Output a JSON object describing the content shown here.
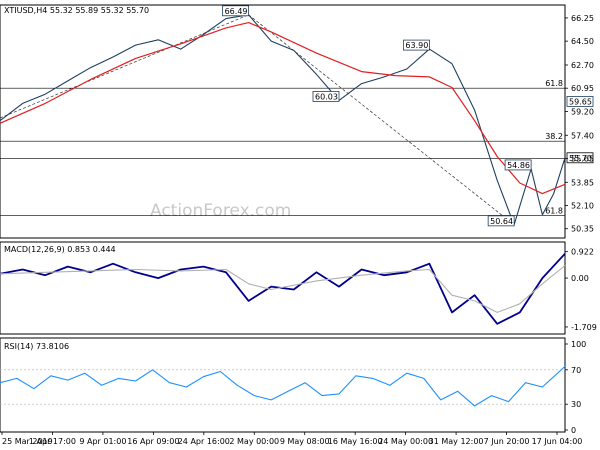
{
  "chart_data": [
    {
      "type": "line",
      "panel": "price",
      "header": "XTIUSD,H4  55.32 55.89 55.32 55.70",
      "ylim": [
        49.8,
        67.0
      ],
      "y_ticks": [
        "66.25",
        "64.50",
        "62.70",
        "60.95",
        "59.20",
        "57.40",
        "55.65",
        "53.85",
        "52.10",
        "50.35"
      ],
      "y_tick_values": [
        66.25,
        64.5,
        62.7,
        60.95,
        59.2,
        57.4,
        55.65,
        53.85,
        52.1,
        50.35
      ],
      "current_price": "55.70",
      "current_price_value": 55.7,
      "series": [
        {
          "kind": "price",
          "color": "#1f3f60",
          "x": [
            0,
            4,
            8,
            12,
            16,
            20,
            24,
            28,
            32,
            36,
            40,
            44,
            48,
            52,
            56,
            60,
            64,
            68,
            72,
            76,
            80,
            84,
            88,
            91,
            94,
            96,
            98,
            100
          ],
          "y": [
            58.5,
            59.8,
            60.5,
            61.5,
            62.5,
            63.3,
            64.2,
            64.6,
            63.9,
            65.0,
            66.2,
            66.49,
            64.5,
            63.8,
            62.0,
            60.03,
            61.3,
            61.8,
            62.4,
            63.9,
            62.8,
            59.3,
            54.0,
            50.64,
            54.86,
            51.4,
            53.0,
            55.7
          ]
        },
        {
          "kind": "moving-average",
          "color": "#e02020",
          "x": [
            0,
            8,
            16,
            24,
            32,
            40,
            44,
            48,
            56,
            64,
            70,
            76,
            80,
            84,
            88,
            92,
            96,
            100
          ],
          "y": [
            58.3,
            59.8,
            61.6,
            63.2,
            64.3,
            65.5,
            65.9,
            65.2,
            63.6,
            62.2,
            61.9,
            61.8,
            61.0,
            58.5,
            55.8,
            53.8,
            53.0,
            53.7
          ]
        }
      ],
      "levels": [
        {
          "name": "61.8",
          "value": 60.95,
          "color": "#000000"
        },
        {
          "name": "38.2",
          "value": 56.95,
          "color": "#000000"
        },
        {
          "name": "61.8",
          "value": 51.35,
          "color": "#000000"
        },
        {
          "name": "",
          "value": 55.65,
          "color": "#000000"
        }
      ],
      "annotations": [
        {
          "text": "66.49",
          "value": 66.49
        },
        {
          "text": "63.90",
          "value": 63.9
        },
        {
          "text": "60.03",
          "value": 60.03
        },
        {
          "text": "54.86",
          "value": 54.86
        },
        {
          "text": "50.64",
          "value": 50.64
        },
        {
          "text": "59.65",
          "value": 59.65
        }
      ]
    },
    {
      "type": "line",
      "panel": "macd",
      "header": "MACD(12,26,9) 0.853 0.444",
      "ylim": [
        -1.85,
        1.05
      ],
      "y_ticks": [
        "0.922",
        "0.00",
        "-1.709"
      ],
      "y_tick_values": [
        0.922,
        0.0,
        -1.709
      ],
      "series": [
        {
          "kind": "macd",
          "color": "#00008b",
          "x": [
            0,
            4,
            8,
            12,
            16,
            20,
            24,
            28,
            32,
            36,
            40,
            44,
            48,
            52,
            56,
            60,
            64,
            68,
            72,
            76,
            80,
            84,
            88,
            92,
            96,
            100
          ],
          "y": [
            0.15,
            0.3,
            0.1,
            0.4,
            0.2,
            0.5,
            0.2,
            0.0,
            0.3,
            0.4,
            0.2,
            -0.8,
            -0.3,
            -0.4,
            0.2,
            -0.3,
            0.3,
            0.1,
            0.2,
            0.5,
            -1.2,
            -0.6,
            -1.6,
            -1.2,
            0.0,
            0.85
          ]
        },
        {
          "kind": "signal",
          "color": "#b0b0b0",
          "x": [
            0,
            8,
            16,
            24,
            32,
            40,
            44,
            48,
            56,
            64,
            72,
            76,
            80,
            84,
            88,
            92,
            96,
            100
          ],
          "y": [
            0.15,
            0.2,
            0.25,
            0.3,
            0.25,
            0.3,
            -0.2,
            -0.4,
            -0.1,
            0.1,
            0.25,
            0.3,
            -0.6,
            -0.8,
            -1.2,
            -0.9,
            -0.2,
            0.44
          ]
        }
      ]
    },
    {
      "type": "line",
      "panel": "rsi",
      "header": "RSI(14) 73.8106",
      "ylim": [
        0,
        100
      ],
      "y_ticks": [
        "100",
        "70",
        "30",
        "0"
      ],
      "y_tick_values": [
        100,
        70,
        30,
        0
      ],
      "levels": [
        {
          "name": "",
          "value": 70,
          "color": "#b0b0b0"
        },
        {
          "name": "",
          "value": 30,
          "color": "#b0b0b0"
        }
      ],
      "series": [
        {
          "kind": "rsi",
          "color": "#1e90ff",
          "x": [
            0,
            3,
            6,
            9,
            12,
            15,
            18,
            21,
            24,
            27,
            30,
            33,
            36,
            39,
            42,
            45,
            48,
            51,
            54,
            57,
            60,
            63,
            66,
            69,
            72,
            75,
            78,
            81,
            84,
            87,
            90,
            93,
            96,
            100
          ],
          "y": [
            55,
            60,
            48,
            63,
            58,
            66,
            52,
            60,
            57,
            70,
            55,
            50,
            62,
            68,
            52,
            40,
            35,
            45,
            55,
            40,
            42,
            63,
            60,
            52,
            66,
            60,
            35,
            45,
            28,
            40,
            33,
            55,
            50,
            74
          ]
        }
      ],
      "x_ticks": [
        "25 Mar 2019",
        "1 Apr 17:00",
        "9 Apr 01:00",
        "16 Apr 09:00",
        "24 Apr 16:00",
        "2 May 00:00",
        "9 May 08:00",
        "16 May 16:00",
        "24 May 00:00",
        "31 May 12:00",
        "7 Jun 20:00",
        "17 Jun 04:00"
      ]
    }
  ],
  "watermark": "ActionForex.com"
}
